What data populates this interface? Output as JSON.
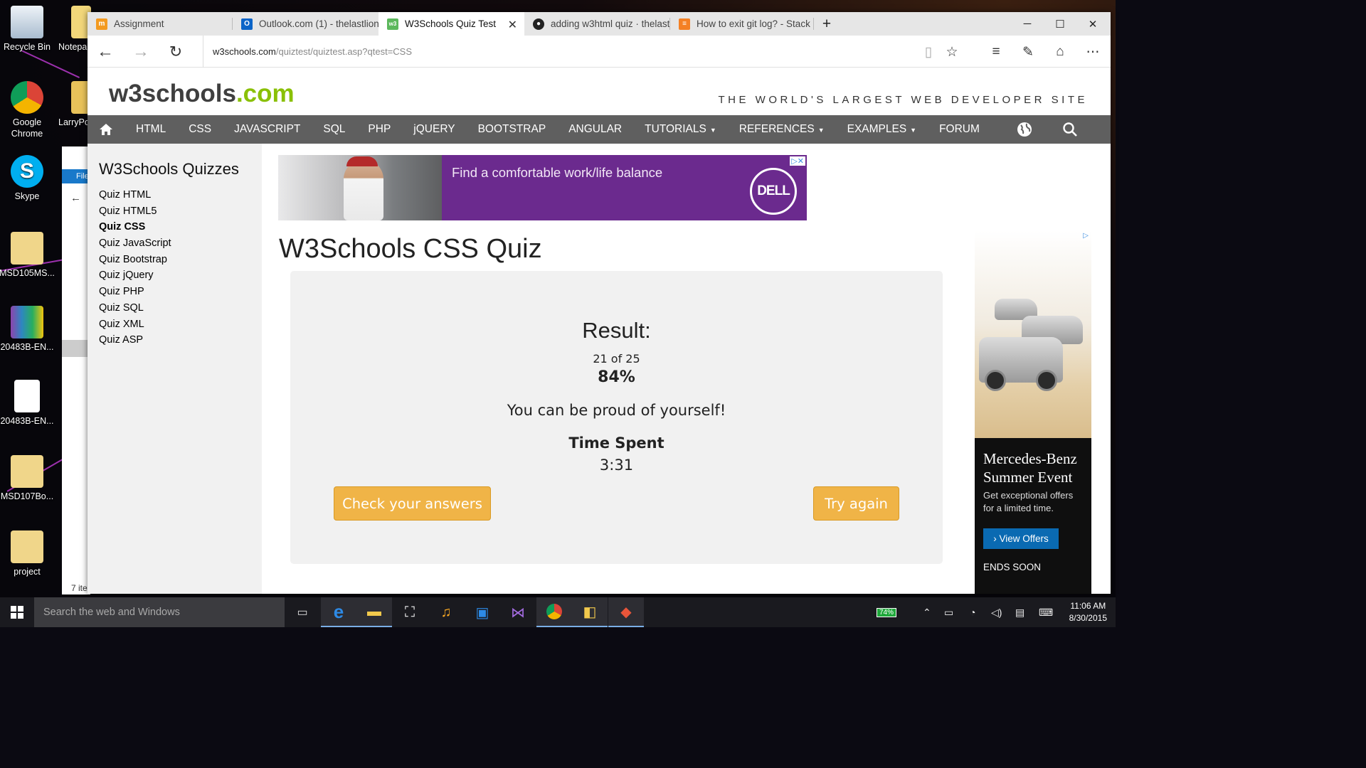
{
  "desktop": {
    "icons": [
      {
        "label": "Recycle Bin",
        "color": "#c9d7e6"
      },
      {
        "label": "Notepa",
        "color": "#f2d77a"
      },
      {
        "label": "Google Chrome",
        "color": "#db4437"
      },
      {
        "label": "LarryPo",
        "color": "#e8c25a"
      },
      {
        "label": "Skype",
        "color": "#00aff0"
      },
      {
        "label": "MSD105MS...",
        "color": "#f0d68a"
      },
      {
        "label": "20483B-EN...",
        "color": "#3a7d2c"
      },
      {
        "label": "20483B-EN...",
        "color": "#ffffff"
      },
      {
        "label": "MSD107Bo...",
        "color": "#f0d68a"
      },
      {
        "label": "project",
        "color": "#f0d68a"
      }
    ],
    "partial_explorer": {
      "file_label": "File",
      "status": "7 ite"
    }
  },
  "browser": {
    "tabs": [
      {
        "title": "Assignment",
        "icon": "moodle-icon",
        "icon_color": "#f39a1f",
        "icon_text": "m"
      },
      {
        "title": "Outlook.com (1) - thelastlion",
        "icon": "outlook-icon",
        "icon_color": "#0a64c8",
        "icon_text": "O"
      },
      {
        "title": "W3Schools Quiz Test",
        "icon": "w3schools-icon",
        "icon_color": "#5cb85c",
        "icon_text": "w3",
        "active": true
      },
      {
        "title": "adding w3html quiz · thelast",
        "icon": "github-icon",
        "icon_color": "#222222",
        "icon_text": "●"
      },
      {
        "title": "How to exit git log? - Stack C",
        "icon": "stackoverflow-icon",
        "icon_color": "#f48024",
        "icon_text": "≡"
      }
    ],
    "new_tab": "+",
    "url_domain": "w3schools.com",
    "url_path": "/quiztest/quiztest.asp?qtest=CSS"
  },
  "site": {
    "logo_main": "w3schools",
    "logo_tld": ".com",
    "tagline": "THE WORLD'S LARGEST WEB DEVELOPER SITE",
    "nav": [
      {
        "label": "HTML"
      },
      {
        "label": "CSS"
      },
      {
        "label": "JAVASCRIPT"
      },
      {
        "label": "SQL"
      },
      {
        "label": "PHP"
      },
      {
        "label": "jQUERY"
      },
      {
        "label": "BOOTSTRAP"
      },
      {
        "label": "ANGULAR"
      },
      {
        "label": "TUTORIALS",
        "dropdown": true
      },
      {
        "label": "REFERENCES",
        "dropdown": true
      },
      {
        "label": "EXAMPLES",
        "dropdown": true
      },
      {
        "label": "FORUM"
      }
    ],
    "sidebar": {
      "title": "W3Schools Quizzes",
      "items": [
        {
          "label": "Quiz HTML"
        },
        {
          "label": "Quiz HTML5"
        },
        {
          "label": "Quiz CSS",
          "active": true
        },
        {
          "label": "Quiz JavaScript"
        },
        {
          "label": "Quiz Bootstrap"
        },
        {
          "label": "Quiz jQuery"
        },
        {
          "label": "Quiz PHP"
        },
        {
          "label": "Quiz SQL"
        },
        {
          "label": "Quiz XML"
        },
        {
          "label": "Quiz ASP"
        }
      ]
    },
    "ad_banner": {
      "message": "Find a comfortable work/life balance",
      "brand": "DELL"
    },
    "quiz": {
      "title": "W3Schools CSS Quiz",
      "result_label": "Result:",
      "score": "21 of 25",
      "percent": "84%",
      "message": "You can be proud of yourself!",
      "time_label": "Time Spent",
      "time_value": "3:31",
      "check_button": "Check your answers",
      "retry_button": "Try again"
    },
    "ad_side": {
      "headline_1": "Mercedes-Benz",
      "headline_2": "Summer Event",
      "body_1": "Get exceptional offers",
      "body_2": "for a limited time.",
      "cta": "View Offers",
      "footer": "ENDS SOON"
    }
  },
  "taskbar": {
    "search_placeholder": "Search the web and Windows",
    "battery": "74%",
    "time": "11:06 AM",
    "date": "8/30/2015"
  },
  "colors": {
    "accent_green": "#8ac007",
    "button_orange": "#f0b447",
    "nav_gray": "#5f5f5f"
  }
}
